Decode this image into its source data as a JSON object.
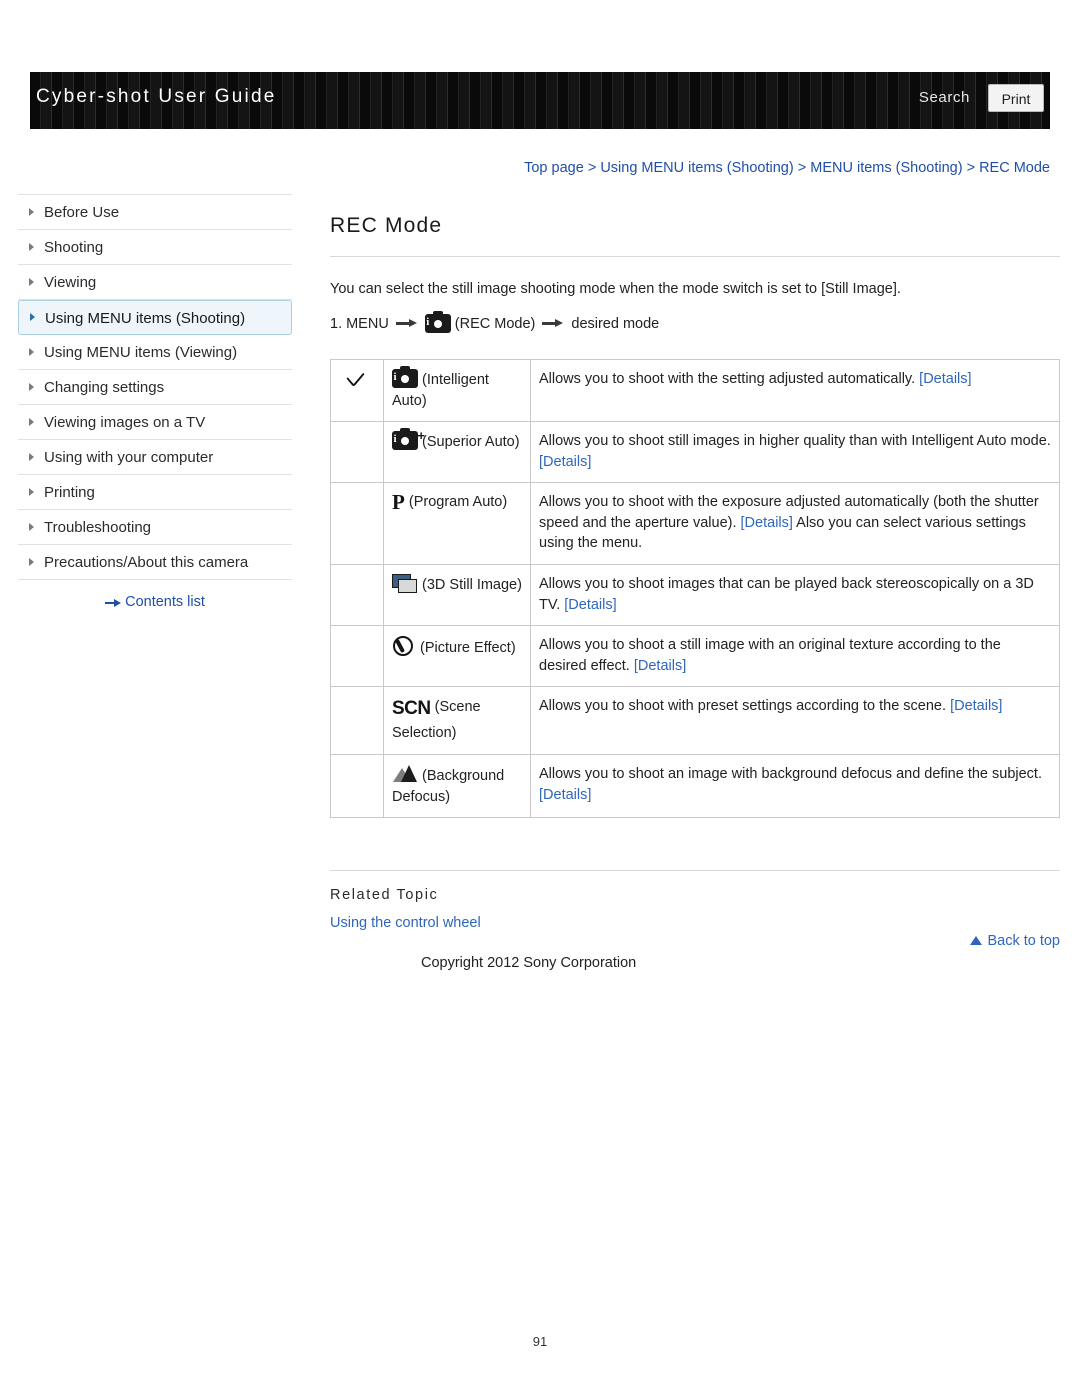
{
  "header": {
    "title": "Cyber-shot User Guide",
    "search_label": "Search",
    "print_label": "Print"
  },
  "breadcrumb": {
    "items": [
      "Top page",
      "Using MENU items (Shooting)",
      "MENU items (Shooting)",
      "REC Mode"
    ],
    "separator": ">"
  },
  "sidebar": {
    "items": [
      {
        "label": "Before Use",
        "active": false
      },
      {
        "label": "Shooting",
        "active": false
      },
      {
        "label": "Viewing",
        "active": false
      },
      {
        "label": "Using MENU items (Shooting)",
        "active": true
      },
      {
        "label": "Using MENU items (Viewing)",
        "active": false
      },
      {
        "label": "Changing settings",
        "active": false
      },
      {
        "label": "Viewing images on a TV",
        "active": false
      },
      {
        "label": "Using with your computer",
        "active": false
      },
      {
        "label": "Printing",
        "active": false
      },
      {
        "label": "Troubleshooting",
        "active": false
      },
      {
        "label": "Precautions/About this camera",
        "active": false
      }
    ],
    "contents_list": "Contents list"
  },
  "main": {
    "title": "REC Mode",
    "intro": "You can select the still image shooting mode when the mode switch is set to [Still Image].",
    "step_number": "1.",
    "step_menu": "MENU",
    "step_rec_mode": "(REC Mode)",
    "step_desired": "desired mode",
    "table": {
      "rows": [
        {
          "icon": "check-icon",
          "name": "(Intelligent Auto)",
          "desc_before": "Allows you to shoot with the setting adjusted automatically. ",
          "desc_link": "[Details]",
          "desc_after": ""
        },
        {
          "icon": "camera-plus-icon",
          "name": "(Superior Auto)",
          "desc_before": "Allows you to shoot still images in higher quality than with Intelligent Auto mode. ",
          "desc_link": "[Details]",
          "desc_after": ""
        },
        {
          "icon": "program-p-icon",
          "name": "(Program Auto)",
          "desc_before": "Allows you to shoot with the exposure adjusted automatically (both the shutter speed and the aperture value). ",
          "desc_link": "[Details]",
          "desc_after": "Also you can select various settings using the menu."
        },
        {
          "icon": "3d-still-icon",
          "name": "(3D Still Image)",
          "desc_before": "Allows you to shoot images that can be played back stereoscopically on a 3D TV. ",
          "desc_link": "[Details]",
          "desc_after": ""
        },
        {
          "icon": "picture-effect-icon",
          "name": "(Picture Effect)",
          "desc_before": "Allows you to shoot a still image with an original texture according to the desired effect. ",
          "desc_link": "[Details]",
          "desc_after": ""
        },
        {
          "icon": "scene-selection-icon",
          "name": "(Scene Selection)",
          "desc_before": "Allows you to shoot with preset settings according to the scene. ",
          "desc_link": "[Details]",
          "desc_after": ""
        },
        {
          "icon": "background-defocus-icon",
          "name": "(Background Defocus)",
          "desc_before": "Allows you to shoot an image with background defocus and define the subject. ",
          "desc_link": "[Details]",
          "desc_after": ""
        }
      ]
    },
    "related_title": "Related Topic",
    "related_link": "Using the control wheel"
  },
  "footer": {
    "back_to_top": "Back to top",
    "copyright": "Copyright 2012 Sony Corporation",
    "page_number": "91"
  }
}
